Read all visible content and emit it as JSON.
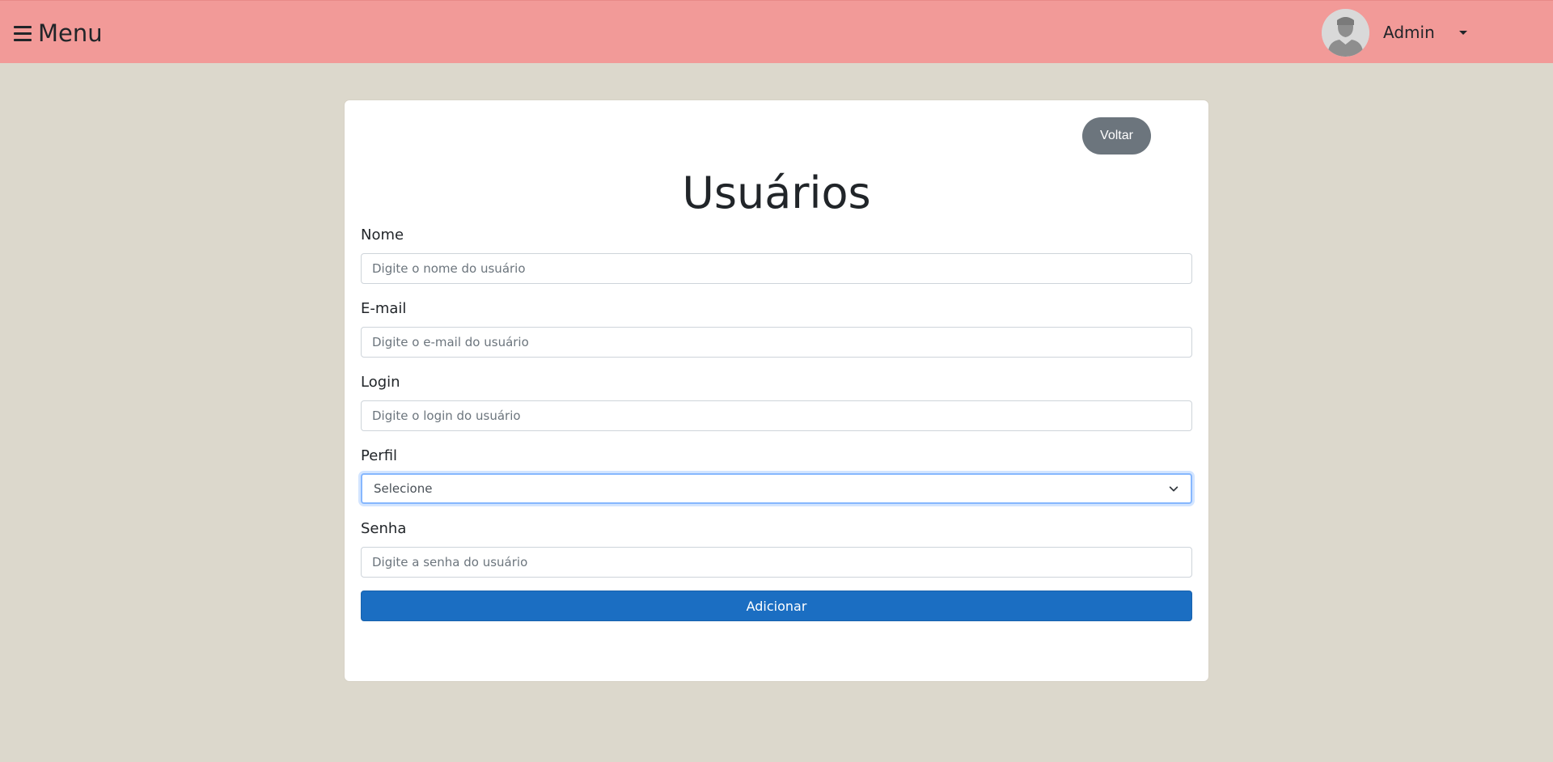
{
  "navbar": {
    "menu_label": "Menu",
    "user_name": "Admin",
    "background": "#f29a98"
  },
  "card": {
    "back_label": "Voltar",
    "title": "Usuários",
    "fields": {
      "nome": {
        "label": "Nome",
        "placeholder": "Digite o nome do usuário"
      },
      "email": {
        "label": "E-mail",
        "placeholder": "Digite o e-mail do usuário"
      },
      "login": {
        "label": "Login",
        "placeholder": "Digite o login do usuário"
      },
      "perfil": {
        "label": "Perfil",
        "selected": "Selecione"
      },
      "senha": {
        "label": "Senha",
        "placeholder": "Digite a senha do usuário"
      }
    },
    "submit_label": "Adicionar"
  },
  "colors": {
    "page_background": "#dcd8cc",
    "primary": "#1b6ec2",
    "secondary": "#6c757d"
  },
  "icons": {
    "menu": "hamburger-icon",
    "avatar": "user-avatar-icon",
    "dropdown": "caret-down-icon",
    "select": "chevron-down-icon"
  }
}
